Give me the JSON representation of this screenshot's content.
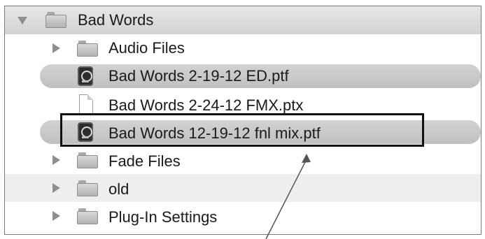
{
  "window": {
    "root_folder": "Bad Words"
  },
  "items": [
    {
      "kind": "folder",
      "label": "Audio Files"
    },
    {
      "kind": "pt-session",
      "label": "Bad Words 2-19-12 ED.ptf"
    },
    {
      "kind": "document",
      "label": "Bad Words 2-24-12 FMX.ptx"
    },
    {
      "kind": "pt-session",
      "label": "Bad Words 12-19-12 fnl mix.ptf"
    },
    {
      "kind": "folder",
      "label": "Fade Files"
    },
    {
      "kind": "folder",
      "label": "old"
    },
    {
      "kind": "folder",
      "label": "Plug-In Settings"
    }
  ],
  "icons": {
    "disclosure_open": "disclosure-triangle-down-icon",
    "disclosure_closed": "disclosure-triangle-right-icon",
    "folder": "folder-icon",
    "pt_session": "pro-tools-session-icon",
    "document": "document-icon"
  },
  "annotation": {
    "highlighted_item": "Bad Words 12-19-12 fnl mix.ptf",
    "box_color": "#111111"
  },
  "colors": {
    "header_bg": "#d9d9d9",
    "selection_pill": "#c8c8c8",
    "stripe": "#eeeeee"
  }
}
